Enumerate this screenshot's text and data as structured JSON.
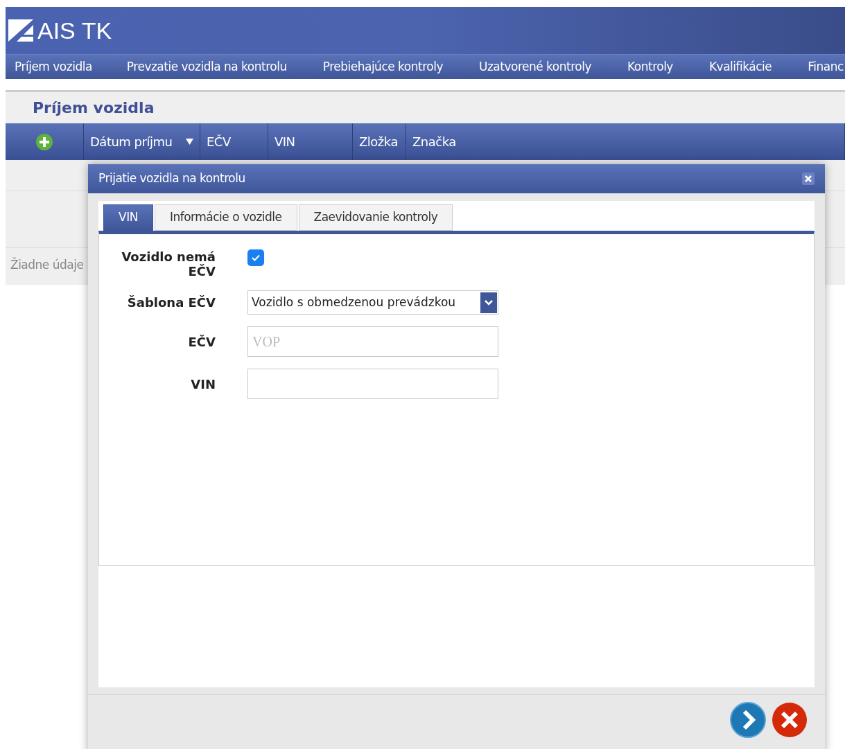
{
  "app": {
    "title": "AIS TK"
  },
  "nav": [
    {
      "label": "Príjem vozidla"
    },
    {
      "label": "Prevzatie vozidla na kontrolu"
    },
    {
      "label": "Prebiehajúce kontroly"
    },
    {
      "label": "Uzatvorené kontroly"
    },
    {
      "label": "Kontroly"
    },
    {
      "label": "Kvalifikácie"
    },
    {
      "label": "Financ"
    }
  ],
  "panel": {
    "title": "Príjem vozidla",
    "columns": [
      {
        "label": "Dátum príjmu",
        "sorted": true
      },
      {
        "label": "EČV",
        "sorted": false
      },
      {
        "label": "VIN",
        "sorted": false
      },
      {
        "label": "Zložka",
        "sorted": false
      },
      {
        "label": "Značka",
        "sorted": false
      }
    ],
    "empty": "Žiadne údaje"
  },
  "dialog": {
    "title": "Prijatie vozidla na kontrolu",
    "tabs": [
      {
        "label": "VIN",
        "selected": true
      },
      {
        "label": "Informácie o vozidle",
        "selected": false
      },
      {
        "label": "Zaevidovanie kontroly",
        "selected": false
      }
    ],
    "fields": [
      {
        "kind": "checkbox",
        "label": "Vozidlo nemá EČV",
        "checked": true
      },
      {
        "kind": "select",
        "label": "Šablona EČV",
        "value": "Vozidlo s obmedzenou prevádzkou"
      },
      {
        "kind": "text",
        "label": "EČV",
        "placeholder": "VOP"
      },
      {
        "kind": "text",
        "label": "VIN"
      }
    ]
  }
}
